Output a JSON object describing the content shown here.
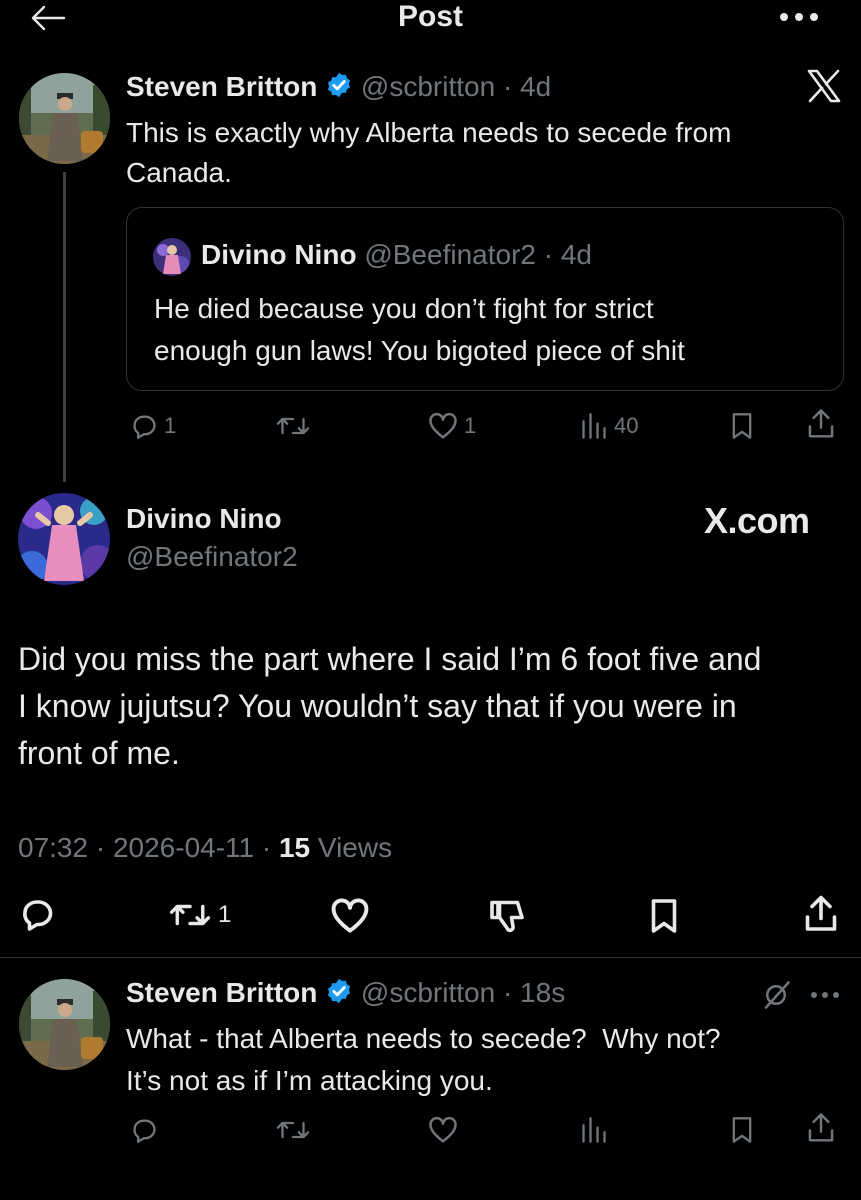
{
  "header": {
    "title": "Post"
  },
  "post1": {
    "name": "Steven Britton",
    "handle": "@scbritton",
    "time": "· 4d",
    "text_line1": "This is exactly why Alberta needs to secede from",
    "text_line2": "Canada.",
    "brand": "X",
    "quote": {
      "name": "Divino Nino",
      "handle": "@Beefinator2",
      "time": "· 4d",
      "text_line1": "He died because you don’t fight for strict",
      "text_line2": "enough gun laws! You bigoted piece of shit"
    },
    "actions": {
      "replies": "1",
      "likes": "1",
      "views": "40"
    }
  },
  "main": {
    "name": "Divino Nino",
    "handle": "@Beefinator2",
    "brand": "X.com",
    "text_line1": "Did you miss the part where I said I’m 6 foot five and",
    "text_line2": "I know jujutsu? You wouldn’t say that if you were in",
    "text_line3": "front of me.",
    "timestamp": "07:32 · 2026-04-11 · ",
    "views_count": "15",
    "views_label": " Views",
    "actions": {
      "reposts": "1"
    }
  },
  "reply": {
    "name": "Steven Britton",
    "handle": "@scbritton",
    "time": "· 18s",
    "text_line1": "What - that Alberta needs to secede?  Why not?",
    "text_line2": "It’s not as if I’m attacking you."
  },
  "colors": {
    "background": "#000000",
    "text": "#e7e9ea",
    "muted": "#71767b",
    "verified": "#1d9bf0",
    "border": "#2f3336"
  }
}
